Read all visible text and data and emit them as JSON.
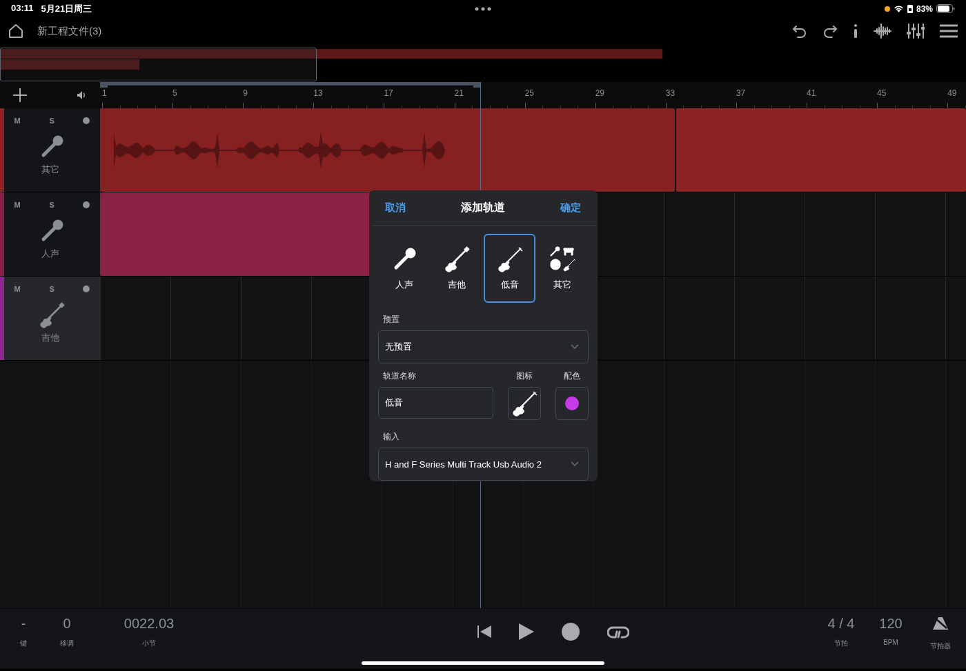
{
  "status_bar": {
    "time": "03:11",
    "date": "5月21日周三",
    "battery": "83%"
  },
  "toolbar": {
    "title": "新工程文件(3)"
  },
  "ruler": [
    "1",
    "5",
    "9",
    "13",
    "17",
    "21",
    "25",
    "29",
    "33",
    "37",
    "41",
    "45",
    "49"
  ],
  "tracks": [
    {
      "name": "其它",
      "kind": "mic",
      "mute": "M",
      "solo": "S",
      "color": "#8e2323",
      "selected": false
    },
    {
      "name": "人声",
      "kind": "mic",
      "mute": "M",
      "solo": "S",
      "color": "#8a2246",
      "selected": false
    },
    {
      "name": "吉他",
      "kind": "guitar",
      "mute": "M",
      "solo": "S",
      "color": "#8a2a90",
      "selected": true
    }
  ],
  "dialog": {
    "cancel": "取消",
    "title": "添加轨道",
    "confirm": "确定",
    "types": [
      {
        "label": "人声",
        "kind": "mic",
        "selected": false
      },
      {
        "label": "吉他",
        "kind": "guitar",
        "selected": false
      },
      {
        "label": "低音",
        "kind": "bass",
        "selected": true
      },
      {
        "label": "其它",
        "kind": "other",
        "selected": false
      }
    ],
    "preset_label": "预置",
    "preset": "无预置",
    "name_label": "轨道名称",
    "name": "低音",
    "icon_label": "图标",
    "color_label": "配色",
    "color": "#c83ae8",
    "input_label": "输入",
    "input": "H and F Series Multi Track Usb Audio 2"
  },
  "bottom": {
    "fields": [
      {
        "value": "-",
        "label": "键"
      },
      {
        "value": "0",
        "label": "移调"
      },
      {
        "value": "0022.03",
        "label": "小节"
      }
    ],
    "meter": {
      "value": "4 / 4",
      "label": "节拍"
    },
    "tempo": {
      "value": "120",
      "label": "BPM"
    },
    "metronome": "节拍器"
  }
}
